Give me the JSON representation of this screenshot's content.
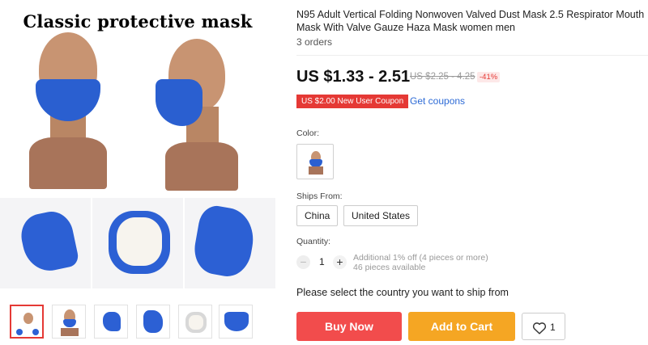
{
  "gallery": {
    "main_title": "Classic protective mask"
  },
  "product": {
    "title": "N95 Adult Vertical Folding Nonwoven Valved Dust Mask 2.5 Respirator Mouth Mask With Valve Gauze Haza Mask women men",
    "orders": "3 orders",
    "price": "US $1.33 - 2.51",
    "old_price": "US $2.25 - 4.25",
    "discount": "-41%",
    "coupon": "US $2.00 New User Coupon",
    "get_coupons": "Get coupons"
  },
  "options": {
    "color_label": "Color:",
    "ships_from_label": "Ships From:",
    "ships_from": [
      "China",
      "United States"
    ],
    "quantity_label": "Quantity:",
    "quantity_value": "1",
    "quantity_minus": "−",
    "quantity_plus": "+",
    "quantity_note_1": "Additional 1% off (4 pieces or more)",
    "quantity_note_2": "46 pieces available"
  },
  "shipping_message": "Please select the country you want to ship from",
  "actions": {
    "buy_now": "Buy Now",
    "add_to_cart": "Add to Cart",
    "wishlist_count": "1"
  },
  "colors": {
    "buy_now": "#f24c4c",
    "add_to_cart": "#f5a623",
    "coupon": "#e53935",
    "link": "#2e6bd6",
    "mask_blue": "#2a5fd0"
  },
  "icons": {
    "wishlist": "heart-outline-icon",
    "minus": "minus-icon",
    "plus": "plus-icon"
  }
}
